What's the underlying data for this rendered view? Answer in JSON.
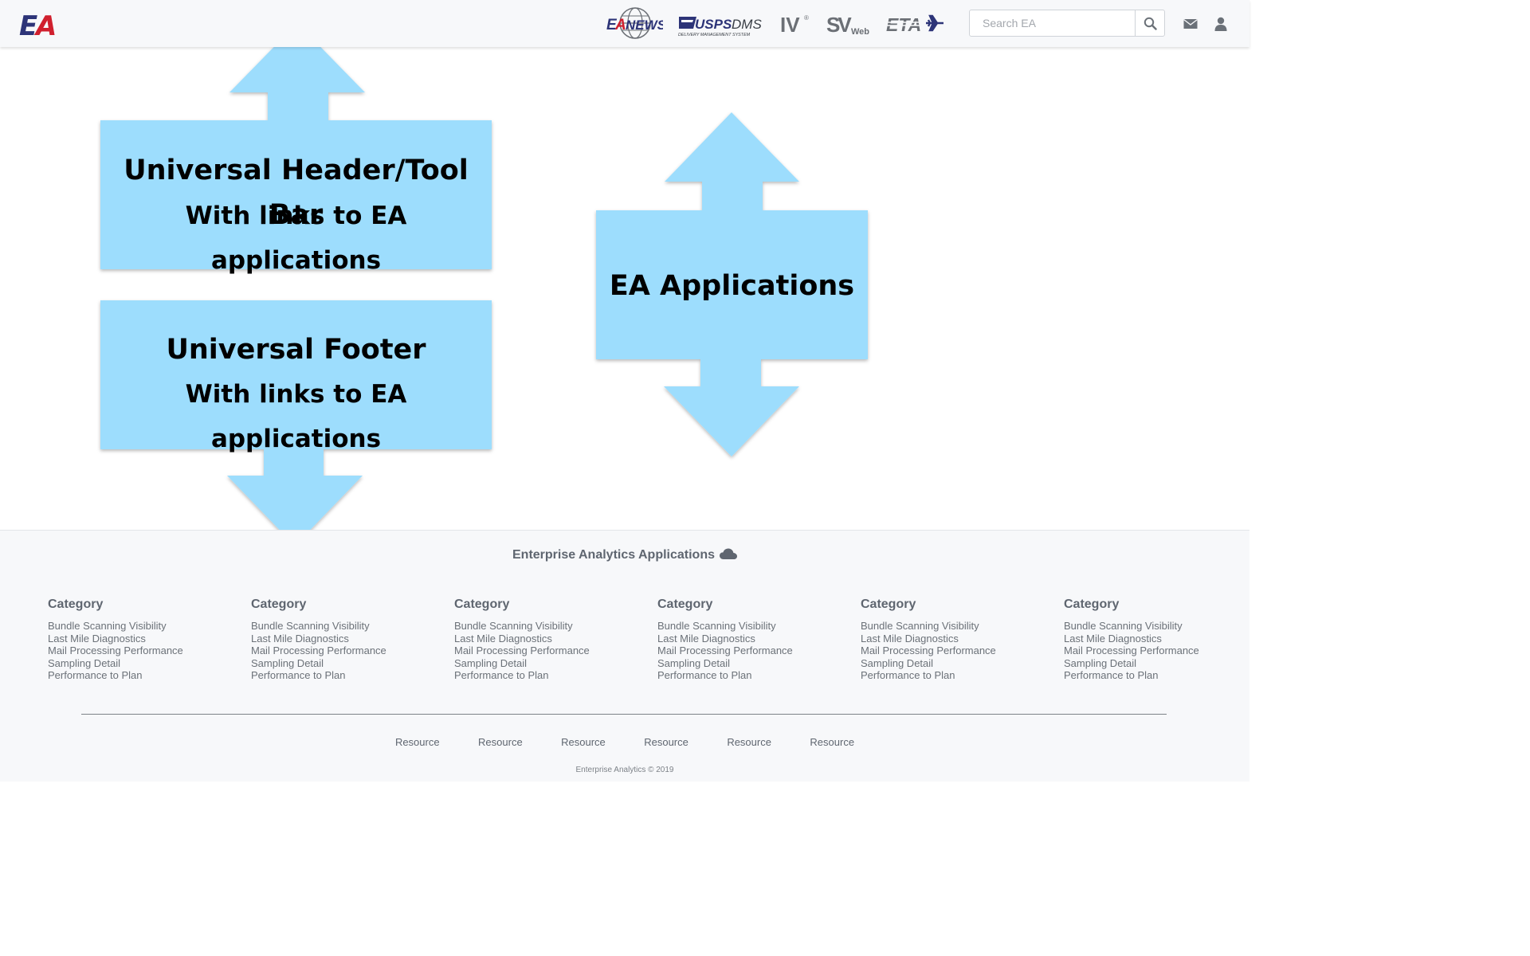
{
  "header": {
    "logo_text": "EA",
    "apps": [
      {
        "name": "EA News",
        "text": "EANEWS"
      },
      {
        "name": "USPS DMS",
        "text": "USPS DMS",
        "sub": "DELIVERY MANAGEMENT SYSTEM"
      },
      {
        "name": "IV",
        "text": "IV"
      },
      {
        "name": "SV Web",
        "text": "SV",
        "sub": "Web"
      },
      {
        "name": "ETA",
        "text": "ETA"
      }
    ],
    "search_placeholder": "Search EA"
  },
  "diagram": {
    "header_box": {
      "line1": "Universal Header/Tool Bar",
      "line2": "With links to EA applications"
    },
    "footer_box": {
      "line1": "Universal Footer",
      "line2": "With links to EA applications"
    },
    "apps_box": {
      "line1": "EA Applications"
    },
    "fill_color": "#9dddfd"
  },
  "footer": {
    "title": "Enterprise Analytics Applications",
    "categories": [
      {
        "heading": "Category",
        "links": [
          "Bundle Scanning Visibility",
          "Last Mile Diagnostics",
          "Mail Processing Performance",
          "Sampling Detail",
          "Performance to Plan"
        ]
      },
      {
        "heading": "Category",
        "links": [
          "Bundle Scanning Visibility",
          "Last Mile Diagnostics",
          "Mail Processing Performance",
          "Sampling Detail",
          "Performance to Plan"
        ]
      },
      {
        "heading": "Category",
        "links": [
          "Bundle Scanning Visibility",
          "Last Mile Diagnostics",
          "Mail Processing Performance",
          "Sampling Detail",
          "Performance to Plan"
        ]
      },
      {
        "heading": "Category",
        "links": [
          "Bundle Scanning Visibility",
          "Last Mile Diagnostics",
          "Mail Processing Performance",
          "Sampling Detail",
          "Performance to Plan"
        ]
      },
      {
        "heading": "Category",
        "links": [
          "Bundle Scanning Visibility",
          "Last Mile Diagnostics",
          "Mail Processing Performance",
          "Sampling Detail",
          "Performance to Plan"
        ]
      },
      {
        "heading": "Category",
        "links": [
          "Bundle Scanning Visibility",
          "Last Mile Diagnostics",
          "Mail Processing Performance",
          "Sampling Detail",
          "Performance to Plan"
        ]
      }
    ],
    "resources": [
      "Resource",
      "Resource",
      "Resource",
      "Resource",
      "Resource",
      "Resource"
    ],
    "copyright": "Enterprise Analytics © 2019"
  },
  "colors": {
    "brand_red": "#d0202e",
    "brand_navy": "#2d3478",
    "header_bg": "#f7f8fa",
    "footer_bg": "#f7f8fa",
    "arrow_fill": "#9dddfd"
  }
}
